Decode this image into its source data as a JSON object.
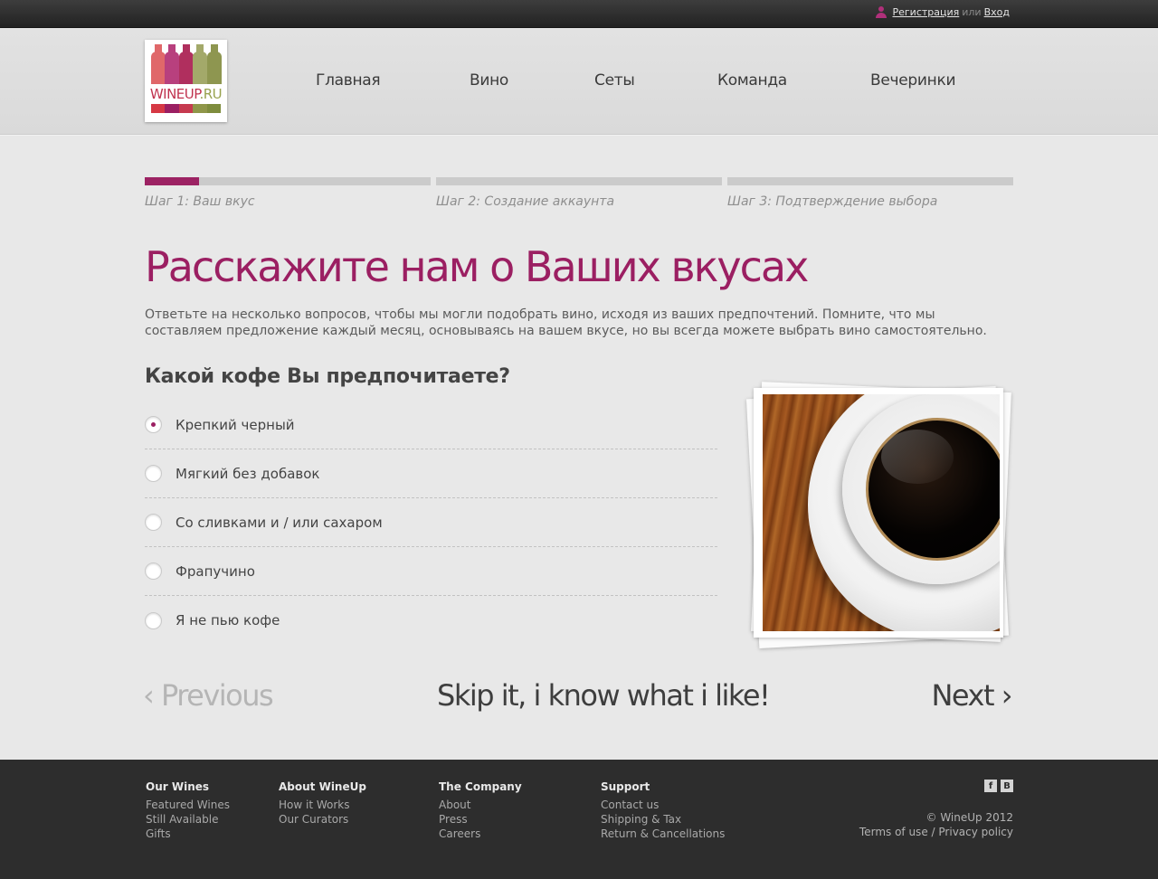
{
  "topbar": {
    "register_label": "Регистрация",
    "or_label": "или",
    "login_label": "Вход"
  },
  "logo": {
    "text_main": "WINEUP",
    "text_tld": ".RU",
    "bottle_colors": [
      "#e0686a",
      "#b8407e",
      "#b02f5e",
      "#a3a96a",
      "#8e9650"
    ],
    "base_colors": [
      "#d63844",
      "#9b1f62",
      "#c63a4f",
      "#8f9649",
      "#7e8c3d"
    ]
  },
  "nav": {
    "items": [
      "Главная",
      "Вино",
      "Сеты",
      "Команда",
      "Вечеринки"
    ]
  },
  "steps": [
    {
      "label": "Шаг 1: Ваш вкус",
      "progress": 0.19
    },
    {
      "label": "Шаг 2: Создание аккаунта",
      "progress": 0
    },
    {
      "label": "Шаг 3: Подтверждение выбора",
      "progress": 0
    }
  ],
  "page": {
    "title": "Расскажите нам о Ваших вкусах",
    "intro": "Ответьте на несколько вопросов, чтобы мы могли подобрать вино, исходя из ваших предпочтений. Помните, что мы составляем предложение каждый месяц, основываясь на вашем вкусе, но вы всегда можете выбрать вино самостоятельно."
  },
  "question": {
    "text": "Какой кофе Вы предпочитаете?",
    "options": [
      {
        "label": "Крепкий черный",
        "selected": true
      },
      {
        "label": "Мягкий без добавок",
        "selected": false
      },
      {
        "label": "Со сливками и / или сахаром",
        "selected": false
      },
      {
        "label": "Фрапучино",
        "selected": false
      },
      {
        "label": "Я не пью кофе",
        "selected": false
      }
    ]
  },
  "navigation": {
    "previous_label": "‹ Previous",
    "skip_label": "Skip it, i know what i like!",
    "next_label": "Next ›"
  },
  "footer": {
    "columns": [
      {
        "title": "Our Wines",
        "links": [
          "Featured Wines",
          "Still Available",
          "Gifts"
        ]
      },
      {
        "title": "About WineUp",
        "links": [
          "How it Works",
          "Our Curators"
        ]
      },
      {
        "title": "The Company",
        "links": [
          "About",
          "Press",
          "Careers"
        ]
      },
      {
        "title": "Support",
        "links": [
          "Contact us",
          "Shipping & Tax",
          "Return & Cancellations"
        ]
      }
    ],
    "social": [
      "f",
      "В"
    ],
    "copyright": "© WineUp 2012",
    "terms_label": "Terms of use",
    "divider": "/",
    "privacy_label": "Privacy policy"
  },
  "colors": {
    "accent": "#9b1f62",
    "topbar": "#2a2a2a",
    "footer": "#2d2d2d"
  }
}
